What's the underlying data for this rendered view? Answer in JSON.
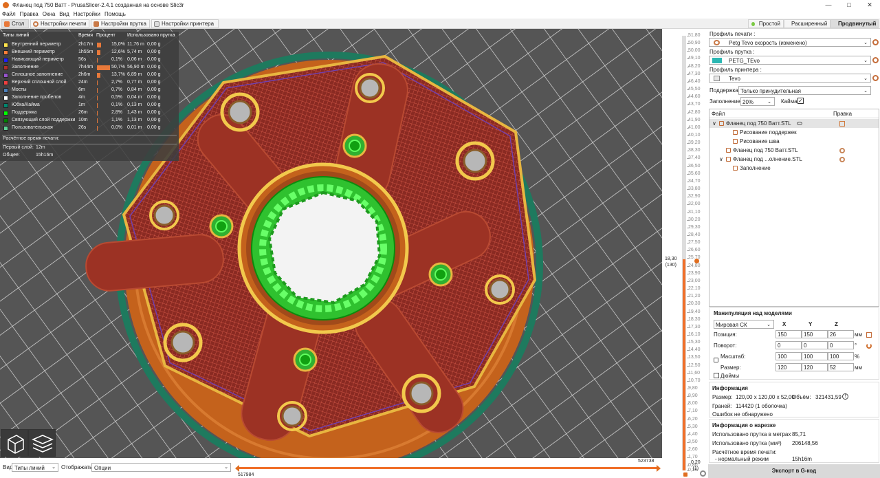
{
  "window": {
    "title": "Фланец под 750 Ватт - PrusaSlicer-2.4.1 созданная на основе Slic3r",
    "controls": [
      "minimize",
      "maximize",
      "close"
    ]
  },
  "menu": [
    "Файл",
    "Правка",
    "Окна",
    "Вид",
    "Настройки",
    "Помощь"
  ],
  "tabs": [
    "Стол",
    "Настройки печати",
    "Настройки прутка",
    "Настройки принтера"
  ],
  "modes": [
    {
      "label": "Простой",
      "color": "#7ac943"
    },
    {
      "label": "Расширенный",
      "color": "#f5c518"
    },
    {
      "label": "Продвинутый",
      "color": "#e0272b"
    }
  ],
  "legend": {
    "headers": [
      "Типы линий",
      "Время",
      "Процент",
      "Использовано прутка"
    ],
    "rows": [
      {
        "name": "Внутренний периметр",
        "time": "2h17m",
        "pct": "15,0%",
        "frac": 0.15,
        "len": "11,76 m",
        "weight": "0,00 g",
        "color": "#ffe64d"
      },
      {
        "name": "Внешний периметр",
        "time": "1h55m",
        "pct": "12,6%",
        "frac": 0.126,
        "len": "5,74 m",
        "weight": "0,00 g",
        "color": "#ff7d38"
      },
      {
        "name": "Нависающий периметр",
        "time": "56s",
        "pct": "0,1%",
        "frac": 0.001,
        "len": "0,06 m",
        "weight": "0,00 g",
        "color": "#1f1fff"
      },
      {
        "name": "Заполнение",
        "time": "7h44m",
        "pct": "50,7%",
        "frac": 0.507,
        "len": "56,90 m",
        "weight": "0,00 g",
        "color": "#b03029"
      },
      {
        "name": "Сплошное заполнение",
        "time": "2h6m",
        "pct": "13,7%",
        "frac": 0.137,
        "len": "6,89 m",
        "weight": "0,00 g",
        "color": "#9654cc"
      },
      {
        "name": "Верхний сплошной слой",
        "time": "24m",
        "pct": "2,7%",
        "frac": 0.027,
        "len": "0,77 m",
        "weight": "0,00 g",
        "color": "#f04040"
      },
      {
        "name": "Мосты",
        "time": "6m",
        "pct": "0,7%",
        "frac": 0.007,
        "len": "0,84 m",
        "weight": "0,00 g",
        "color": "#4d80ba"
      },
      {
        "name": "Заполнение пробелов",
        "time": "4m",
        "pct": "0,5%",
        "frac": 0.005,
        "len": "0,04 m",
        "weight": "0,00 g",
        "color": "#ffffff"
      },
      {
        "name": "Юбка/Кайма",
        "time": "1m",
        "pct": "0,1%",
        "frac": 0.001,
        "len": "0,13 m",
        "weight": "0,00 g",
        "color": "#00876e"
      },
      {
        "name": "Поддержка",
        "time": "26m",
        "pct": "2,8%",
        "frac": 0.028,
        "len": "1,43 m",
        "weight": "0,00 g",
        "color": "#00ff00"
      },
      {
        "name": "Связующий слой поддержки",
        "time": "10m",
        "pct": "1,1%",
        "frac": 0.011,
        "len": "1,13 m",
        "weight": "0,00 g",
        "color": "#008000"
      },
      {
        "name": "Пользовательская",
        "time": "26s",
        "pct": "0,0%",
        "frac": 0.0,
        "len": "0,01 m",
        "weight": "0,00 g",
        "color": "#5ed194"
      }
    ],
    "estimated_title": "Расчётное время печати:",
    "first_layer_label": "Первый слой:",
    "first_layer_value": "12m",
    "total_label": "Общее:",
    "total_value": "15h16m"
  },
  "vslider": {
    "ticks": [
      "51,80",
      "51,50",
      "51,20",
      "50,90",
      "50,60",
      "50,30",
      "50,00",
      "49,70",
      "49,40",
      "49,10",
      "48,80",
      "48,50",
      "48,20",
      "47,90",
      "47,60",
      "47,30",
      "47,00",
      "46,70",
      "46,40",
      "46,10",
      "45,80",
      "45,50",
      "45,20",
      "44,90",
      "44,60",
      "44,30",
      "44,00",
      "43,70",
      "43,40",
      "43,10",
      "42,80",
      "42,50",
      "42,20",
      "41,90",
      "41,60",
      "41,30",
      "41,00",
      "40,70",
      "40,40",
      "40,10",
      "39,80",
      "39,50",
      "39,20",
      "38,90",
      "38,60",
      "38,30",
      "38,00",
      "37,70",
      "37,40",
      "37,10",
      "36,80",
      "36,50",
      "36,20",
      "35,90",
      "35,60",
      "35,30",
      "35,00",
      "34,70",
      "34,40",
      "34,10",
      "33,80",
      "33,50",
      "33,20",
      "32,90",
      "32,60",
      "32,30",
      "32,00",
      "31,70",
      "31,40",
      "31,10",
      "30,80",
      "30,50",
      "30,20",
      "29,90",
      "29,60",
      "29,30",
      "29,00",
      "28,70",
      "28,40",
      "28,10",
      "27,80",
      "27,50",
      "27,20",
      "26,90",
      "26,60",
      "26,30",
      "26,00",
      "25,70",
      "25,40",
      "25,10",
      "24,80",
      "24,50",
      "24,20",
      "23,90",
      "23,60",
      "23,30",
      "23,00",
      "22,70",
      "22,40",
      "22,10",
      "21,80",
      "21,50",
      "21,20",
      "20,90",
      "20,60",
      "20,30",
      "20,00",
      "19,70",
      "19,40",
      "19,10",
      "18,85",
      "18,30",
      "18,00",
      "17,70",
      "17,30",
      "16,80",
      "16,40",
      "16,10",
      "15,80",
      "15,50",
      "15,30",
      "15,00",
      "14,70",
      "14,40",
      "14,10",
      "13,80",
      "13,50",
      "13,20",
      "12,85",
      "12,50",
      "12,20",
      "11,90",
      "11,60",
      "11,30",
      "11,00",
      "10,70",
      "10,40",
      "10,10",
      "9,80",
      "9,50",
      "9,20",
      "8,90",
      "8,60",
      "8,30",
      "8,00",
      "7,70",
      "7,40",
      "7,10",
      "6,80",
      "6,50",
      "6,20",
      "5,90",
      "5,60",
      "5,30",
      "5,00",
      "4,70",
      "4,40",
      "4,10",
      "3,80",
      "3,50",
      "3,20",
      "2,90",
      "2,60",
      "2,30",
      "2,00",
      "1,70",
      "1,40",
      "1,10",
      "0,80",
      "0,50",
      "0,20"
    ],
    "current_value": "18,30",
    "current_layer": "(130)",
    "min_value": "0,20",
    "min_layer": "(1)"
  },
  "bottom": {
    "view_label": "Вид",
    "view_value": "Типы линий",
    "show_label": "Отображать",
    "show_value": "Опции",
    "h_min": "517984",
    "h_max": "523738"
  },
  "sidebar": {
    "print_profile_label": "Профиль печати :",
    "print_profile_value": "Petg Tevo скорость (изменено)",
    "filament_profile_label": "Профиль прутка :",
    "filament_profile_value": "PETG_TEvo",
    "filament_color": "#2bb7b3",
    "printer_profile_label": "Профиль принтера :",
    "printer_profile_value": "Tevo",
    "support_label": "Поддержка:",
    "support_value": "Только принудительная",
    "infill_label": "Заполнение:",
    "infill_value": "20%",
    "brim_label": "Кайма:",
    "list_col_file": "Файл",
    "list_col_edit": "Правка",
    "objects": [
      {
        "label": "Фланец под 750 Ватт.STL",
        "indent": 0,
        "expander": "v",
        "selected": true,
        "eye": true,
        "edit": true
      },
      {
        "label": "Рисование поддержек",
        "indent": 2,
        "expander": "",
        "selected": false,
        "eye": false,
        "edit": false
      },
      {
        "label": "Рисование шва",
        "indent": 2,
        "expander": "",
        "selected": false,
        "eye": false,
        "edit": false
      },
      {
        "label": "Фланец под 750 Ватт.STL",
        "indent": 1,
        "expander": "",
        "selected": false,
        "eye": false,
        "edit": false,
        "gear": true
      },
      {
        "label": "Фланец под ...олнение.STL",
        "indent": 1,
        "expander": "v",
        "selected": false,
        "eye": false,
        "edit": false,
        "gear": true
      },
      {
        "label": "Заполнение",
        "indent": 2,
        "expander": "",
        "selected": false,
        "eye": false,
        "edit": false
      }
    ],
    "manip": {
      "title": "Манипуляция над моделями",
      "cs": "Мировая СК",
      "axes": [
        "X",
        "Y",
        "Z"
      ],
      "position_label": "Позиция:",
      "position": [
        "150",
        "150",
        "26"
      ],
      "position_unit": "мм",
      "rotation_label": "Поворот:",
      "rotation": [
        "0",
        "0",
        "0"
      ],
      "rotation_unit": "°",
      "scale_label": "Масштаб:",
      "scale": [
        "100",
        "100",
        "100"
      ],
      "scale_unit": "%",
      "size_label": "Размер:",
      "size": [
        "120",
        "120",
        "52"
      ],
      "size_unit": "мм",
      "inches_label": "Дюймы"
    },
    "info": {
      "title": "Информация",
      "size_label": "Размер:",
      "size_value": "120,00 x 120,00 x 52,00",
      "volume_label": "Объём:",
      "volume_value": "321431,59",
      "facets_label": "Граней:",
      "facets_value": "114420 (1 оболочка)",
      "errors": "Ошибок не обнаружено"
    },
    "slice": {
      "title": "Информация о нарезке",
      "used_m_label": "Использовано прутка в метрах",
      "used_m_value": "85,71",
      "used_mm3_label": "Использовано прутка (мм³)",
      "used_mm3_value": "206148,56",
      "est_label": "Расчётное время печати:",
      "normal_label": "- нормальный режим",
      "normal_value": "15h16m"
    },
    "export_label": "Экспорт в G-код"
  }
}
